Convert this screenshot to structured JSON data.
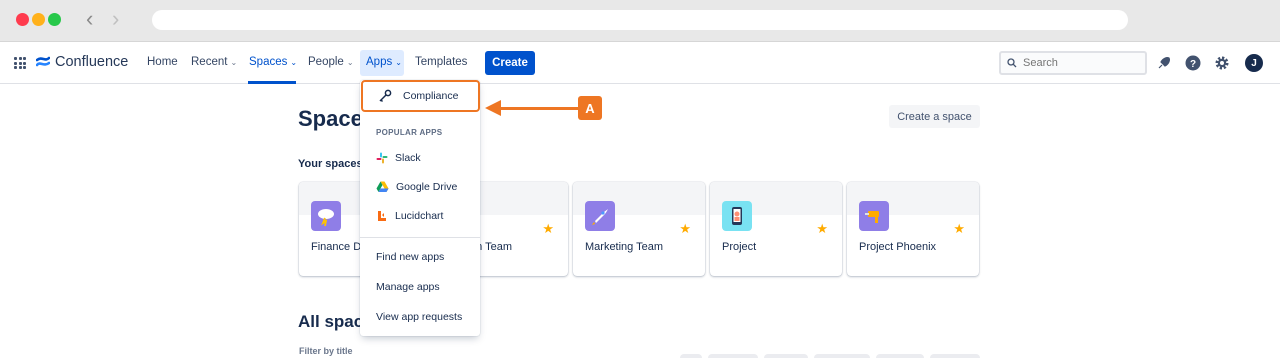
{
  "topnav": {
    "brand": "Confluence",
    "items": [
      {
        "label": "Home"
      },
      {
        "label": "Recent"
      },
      {
        "label": "Spaces"
      },
      {
        "label": "People"
      },
      {
        "label": "Apps"
      },
      {
        "label": "Templates"
      }
    ],
    "create_label": "Create",
    "search_placeholder": "Search",
    "avatar_initial": "J"
  },
  "page": {
    "title": "Spaces",
    "create_space_label": "Create a space",
    "your_spaces_label": "Your spaces",
    "all_spaces_title": "All spaces",
    "filter_label": "Filter by title"
  },
  "spaces": [
    {
      "name": "Finance Department",
      "icon": "storm-cloud-icon",
      "color": "#8f7ee7"
    },
    {
      "name": "Design Team",
      "icon": "space-icon",
      "color": "#6554c0"
    },
    {
      "name": "Marketing Team",
      "icon": "rocket-icon",
      "color": "#8f7ee7"
    },
    {
      "name": "Project",
      "icon": "phone-person-icon",
      "color": "#79e2f2"
    },
    {
      "name": "Project Phoenix",
      "icon": "drill-icon",
      "color": "#8f7ee7"
    }
  ],
  "apps_menu": {
    "featured": "Compliance",
    "popular_heading": "POPULAR APPS",
    "popular": [
      {
        "label": "Slack",
        "icon": "slack-icon"
      },
      {
        "label": "Google Drive",
        "icon": "google-drive-icon"
      },
      {
        "label": "Lucidchart",
        "icon": "lucidchart-icon"
      }
    ],
    "actions": [
      {
        "label": "Find new apps"
      },
      {
        "label": "Manage apps"
      },
      {
        "label": "View app requests"
      }
    ]
  },
  "annotation": {
    "marker": "A",
    "color": "#ee7623"
  }
}
